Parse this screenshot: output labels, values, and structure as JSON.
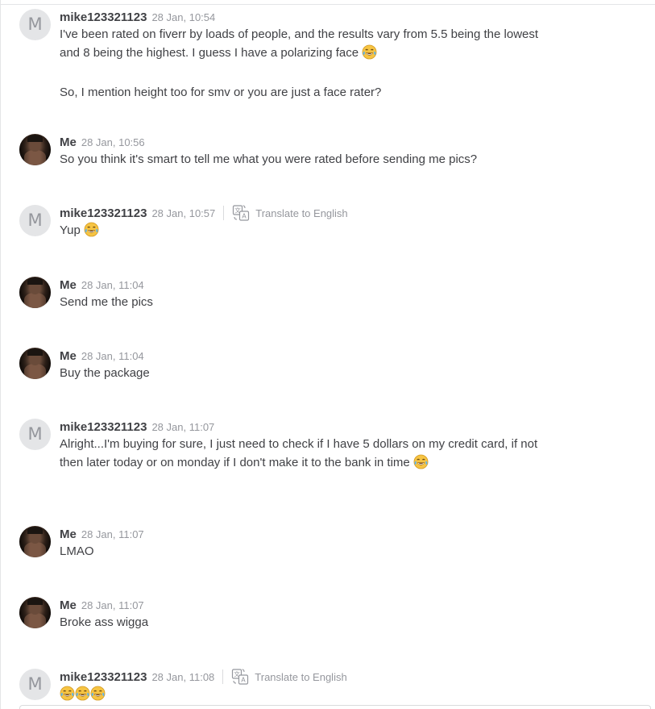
{
  "labels": {
    "translate": "Translate to English"
  },
  "icons": {
    "translate": "translate-icon",
    "laugh": "tears-of-joy-emoji"
  },
  "messages": [
    {
      "sender": "mike123321123",
      "avatar_letter": "M",
      "time": "28 Jan, 10:54",
      "translate": false,
      "lines": [
        "I've been rated on fiverr by loads of people, and the results vary from 5.5 being the lowest and 8 being the highest. I guess I have a polarizing face",
        "So, I mention height too for smv or you are just a face rater?"
      ]
    },
    {
      "sender": "Me",
      "time": "28 Jan, 10:56",
      "lines": [
        "So you think it's smart to tell me what you were rated before sending me pics?"
      ]
    },
    {
      "sender": "mike123321123",
      "avatar_letter": "M",
      "time": "28 Jan, 10:57",
      "translate": true,
      "lines": [
        "Yup"
      ]
    },
    {
      "sender": "Me",
      "time": "28 Jan, 11:04",
      "lines": [
        "Send me the pics"
      ]
    },
    {
      "sender": "Me",
      "time": "28 Jan, 11:04",
      "lines": [
        "Buy the package"
      ]
    },
    {
      "sender": "mike123321123",
      "avatar_letter": "M",
      "time": "28 Jan, 11:07",
      "translate": false,
      "lines": [
        "Alright...I'm buying for sure, I just need to check if I have 5 dollars on my credit card, if not then later today or on monday if I don't make it to the bank in time"
      ]
    },
    {
      "sender": "Me",
      "time": "28 Jan, 11:07",
      "lines": [
        "LMAO"
      ]
    },
    {
      "sender": "Me",
      "time": "28 Jan, 11:07",
      "lines": [
        "Broke ass wigga"
      ]
    },
    {
      "sender": "mike123321123",
      "avatar_letter": "M",
      "time": "28 Jan, 11:08",
      "translate": true,
      "lines": []
    }
  ],
  "colors": {
    "text": "#404145",
    "muted": "#95979d",
    "divider": "#dadbdd",
    "avatar_bg": "#e4e5e7",
    "emoji_face": "#f6c443"
  }
}
